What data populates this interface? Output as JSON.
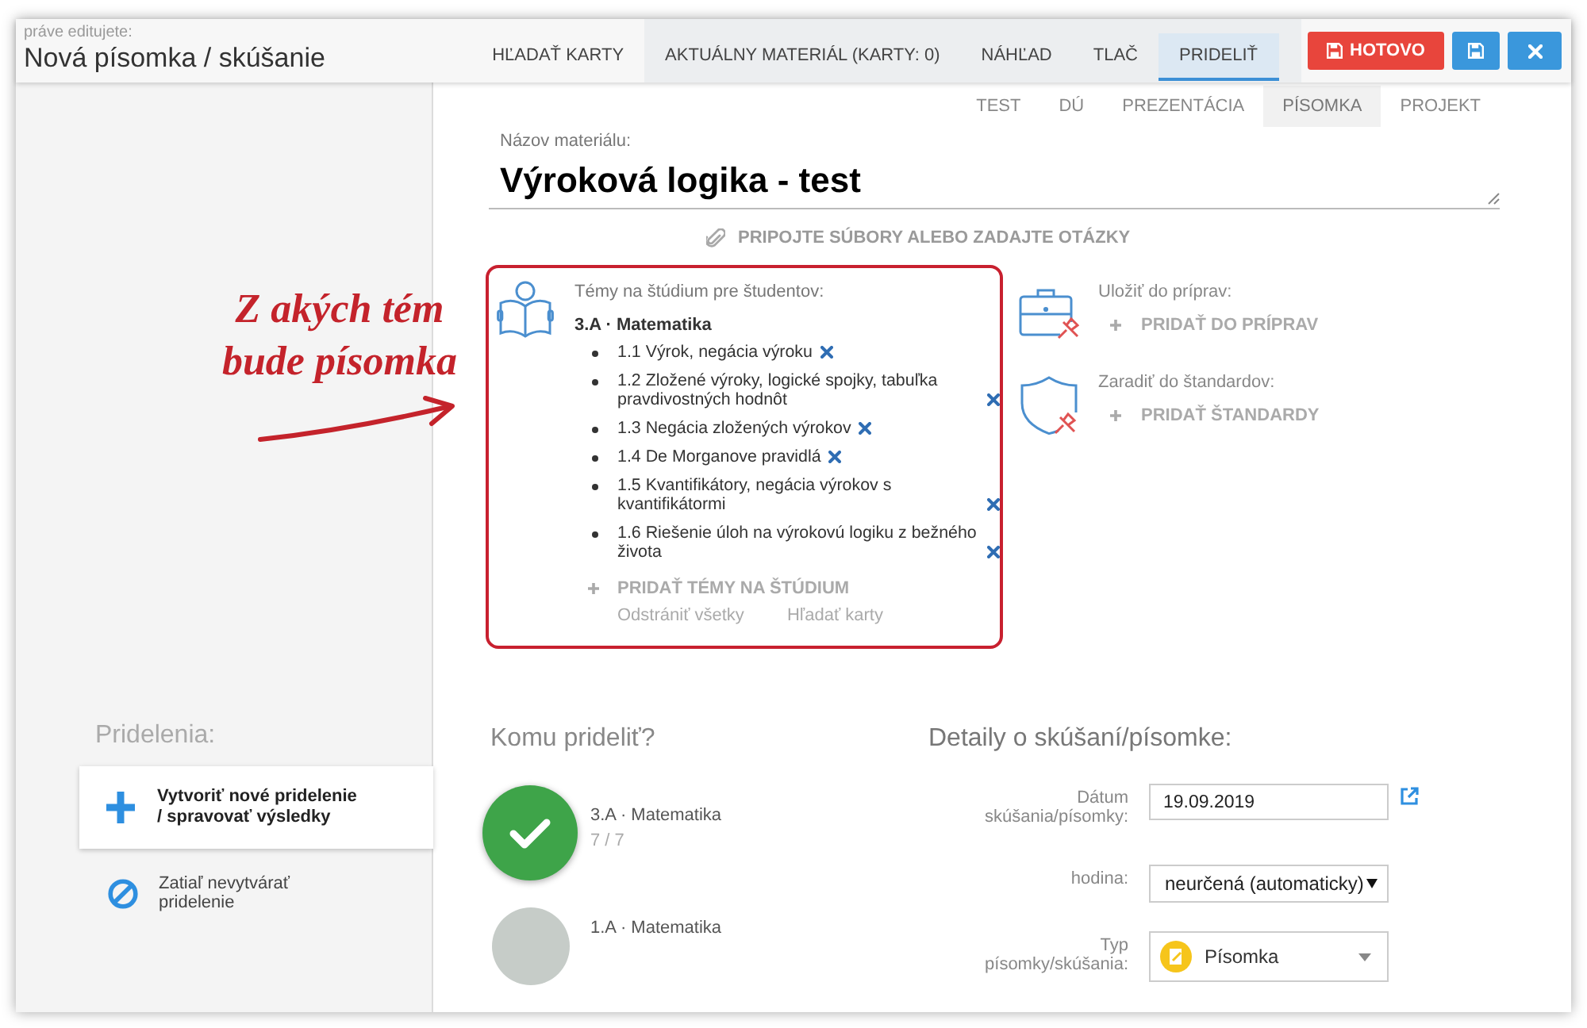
{
  "header": {
    "caption": "práve editujete:",
    "title": "Nová písomka / skúšanie",
    "tabs": [
      {
        "label": "HĽADAŤ KARTY",
        "selected": false
      },
      {
        "label": "AKTUÁLNY MATERIÁL (KARTY: 0)",
        "selected": false
      },
      {
        "label": "NÁHĽAD",
        "selected": false
      },
      {
        "label": "TLAČ",
        "selected": false
      },
      {
        "label": "PRIDELIŤ",
        "selected": true
      }
    ],
    "buttons": [
      {
        "kind": "done",
        "label": "HOTOVO"
      },
      {
        "kind": "save"
      },
      {
        "kind": "close"
      }
    ]
  },
  "material_types": [
    {
      "label": "TEST",
      "selected": false
    },
    {
      "label": "DÚ",
      "selected": false
    },
    {
      "label": "PREZENTÁCIA",
      "selected": false
    },
    {
      "label": "PÍSOMKA",
      "selected": true
    },
    {
      "label": "PROJEKT",
      "selected": false
    }
  ],
  "name_field": {
    "label": "Názov materiálu:",
    "value": "Výroková logika - test"
  },
  "attach_link": "PRIPOJTE SÚBORY ALEBO ZADAJTE OTÁZKY",
  "topics": {
    "heading": "Témy na štúdium pre študentov:",
    "group": "3.A · Matematika",
    "items": [
      "1.1 Výrok, negácia výroku",
      "1.2 Zložené výroky, logické spojky, tabuľka pravdivostných hodnôt",
      "1.3 Negácia zložených výrokov",
      "1.4 De Morganove pravidlá",
      "1.5 Kvantifikátory, negácia výrokov s kvantifikátormi",
      "1.6 Riešenie úloh na výrokovú logiku z bežného života"
    ],
    "add_link": "PRIDAŤ TÉMY NA ŠTÚDIUM",
    "links": [
      "Odstrániť všetky",
      "Hľadať karty"
    ]
  },
  "annotation": {
    "text": "Z akých tém bude písomka"
  },
  "side_actions": [
    {
      "kind": "briefcase",
      "label": "Uložiť do príprav:",
      "action": "PRIDAŤ DO PRÍPRAV"
    },
    {
      "kind": "shield",
      "label": "Zaradiť do štandardov:",
      "action": "PRIDAŤ ŠTANDARDY"
    }
  ],
  "assignments": {
    "heading": "Pridelenia:",
    "options": [
      {
        "kind": "create",
        "label": "Vytvoriť nové pridelenie / spravovať výsledky",
        "selected": true
      },
      {
        "kind": "none",
        "label": "Zatiaľ nevytvárať pridelenie",
        "selected": false
      }
    ]
  },
  "recipients": {
    "heading": "Komu prideliť?",
    "classes": [
      {
        "name": "3.A · Matematika",
        "count": "7 / 7",
        "selected": true
      },
      {
        "name": "1.A · Matematika",
        "selected": false
      }
    ]
  },
  "details": {
    "heading": "Detaily o skúšaní/písomke:",
    "fields": [
      {
        "kind": "date",
        "label": "Dátum skúšania/písomky:",
        "value": "19.09.2019"
      },
      {
        "kind": "select",
        "label": "hodina:",
        "value": "neurčená (automaticky)"
      },
      {
        "kind": "type",
        "label": "Typ písomky/skúšania:",
        "value": "Písomka"
      }
    ]
  }
}
